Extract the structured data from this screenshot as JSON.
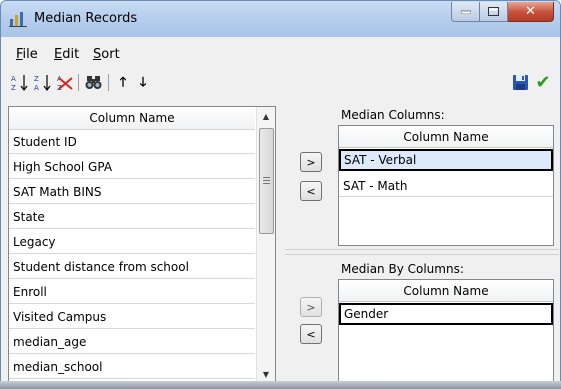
{
  "window": {
    "title": "Median Records"
  },
  "menu": {
    "items": [
      {
        "label": "File",
        "mnemonic": "F",
        "rest": "ile"
      },
      {
        "label": "Edit",
        "mnemonic": "E",
        "rest": "dit"
      },
      {
        "label": "Sort",
        "mnemonic": "S",
        "rest": "ort"
      }
    ]
  },
  "toolbar": {
    "sort_asc_icon": "sort-a-z-icon",
    "sort_desc_icon": "sort-z-a-icon",
    "clear_sort_icon": "clear-sort-icon",
    "find_icon": "binoculars-icon",
    "move_up_glyph": "🡑",
    "move_down_glyph": "🡓",
    "save_icon": "save-icon",
    "ok_glyph": "✔",
    "accent_color": "#2e9a1e"
  },
  "columns_list": {
    "header": "Column Name",
    "items": [
      "Student ID",
      "High School GPA",
      "SAT Math BINS",
      "State",
      "Legacy",
      "Student distance from school",
      "Enroll",
      "Visited Campus",
      "median_age",
      "median_school"
    ]
  },
  "median_columns": {
    "label": "Median Columns:",
    "header": "Column Name",
    "add_label": ">",
    "remove_label": "<",
    "items": [
      "SAT - Verbal",
      "SAT - Math"
    ]
  },
  "median_by_columns": {
    "label": "Median By Columns:",
    "header": "Column Name",
    "add_label": ">",
    "remove_label": "<",
    "items": [
      "Gender"
    ]
  }
}
